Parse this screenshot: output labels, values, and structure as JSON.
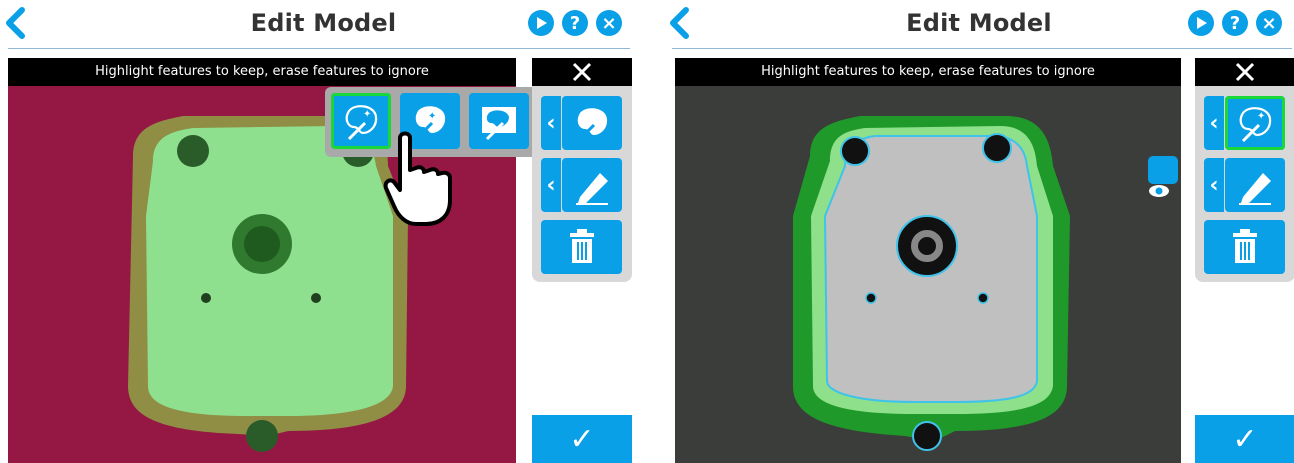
{
  "left_panel": {
    "title": "Edit Model",
    "hint": "Highlight features to keep, erase features to ignore",
    "tools_icon": "tools-icon",
    "popup_tools": [
      "magic-wand-select-icon",
      "magic-wand-add-icon",
      "magic-wand-region-icon"
    ],
    "confirm_icon": "checkmark-icon"
  },
  "right_panel": {
    "title": "Edit Model",
    "hint": "Highlight features to keep, erase features to ignore",
    "tools_icon": "tools-icon",
    "confirm_icon": "checkmark-icon"
  },
  "header_icons": [
    "play-icon",
    "help-icon",
    "close-icon"
  ],
  "header_glyphs": {
    "help": "?",
    "close": "×"
  },
  "colors": {
    "accent": "#0aa0e8",
    "selection": "#19d83a",
    "mask_green": "#8ee08e",
    "left_background": "#951844"
  }
}
